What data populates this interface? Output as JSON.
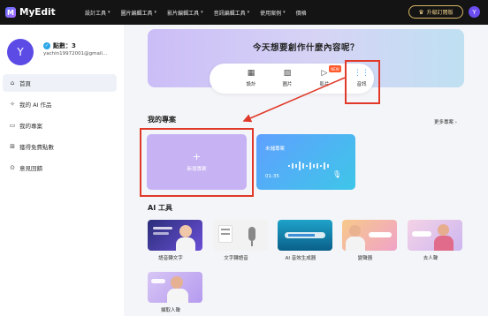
{
  "app": {
    "logo_text": "MyEdit",
    "logo_mark": "M"
  },
  "nav": {
    "items": [
      {
        "label": "設計工具"
      },
      {
        "label": "圖片編輯工具"
      },
      {
        "label": "影片編輯工具"
      },
      {
        "label": "音訊編輯工具"
      },
      {
        "label": "使用案例"
      },
      {
        "label": "價格"
      }
    ],
    "chevron": "▾",
    "upgrade_label": "升級訂閱版",
    "avatar_letter": "Y"
  },
  "sidebar": {
    "avatar_letter": "Y",
    "points_label": "點數：3",
    "email": "yachin19972001@gmail...",
    "menu": [
      {
        "label": "首頁",
        "icon": "home-icon"
      },
      {
        "label": "我的 AI 作品",
        "icon": "ai-sparkle-icon"
      },
      {
        "label": "我的專案",
        "icon": "folder-icon"
      },
      {
        "label": "獲得免費點數",
        "icon": "gift-icon"
      },
      {
        "label": "意見回饋",
        "icon": "feedback-icon"
      }
    ]
  },
  "hero": {
    "title": "今天想要創作什麼內容呢？",
    "categories": [
      {
        "label": "設計",
        "icon": "design-icon"
      },
      {
        "label": "圖片",
        "icon": "image-icon"
      },
      {
        "label": "影片",
        "icon": "video-icon"
      },
      {
        "label": "音訊",
        "icon": "audio-icon"
      }
    ],
    "new_badge": "NEW"
  },
  "projects": {
    "section_title": "我的專案",
    "more_label": "更多專案 ›",
    "new_card": {
      "plus": "+",
      "label": "新增專案"
    },
    "items": [
      {
        "title": "未儲專案",
        "duration": "01:35"
      }
    ]
  },
  "ai_tools": {
    "section_title": "AI 工具",
    "items": [
      {
        "label": "語音轉文字"
      },
      {
        "label": "文字轉語音"
      },
      {
        "label": "AI 音效生成器"
      },
      {
        "label": "變聲器"
      },
      {
        "label": "去人聲"
      },
      {
        "label": "擷取人聲"
      }
    ]
  },
  "colors": {
    "accent": "#6b4df0",
    "highlight": "#e0392a",
    "topbar": "#141414"
  }
}
